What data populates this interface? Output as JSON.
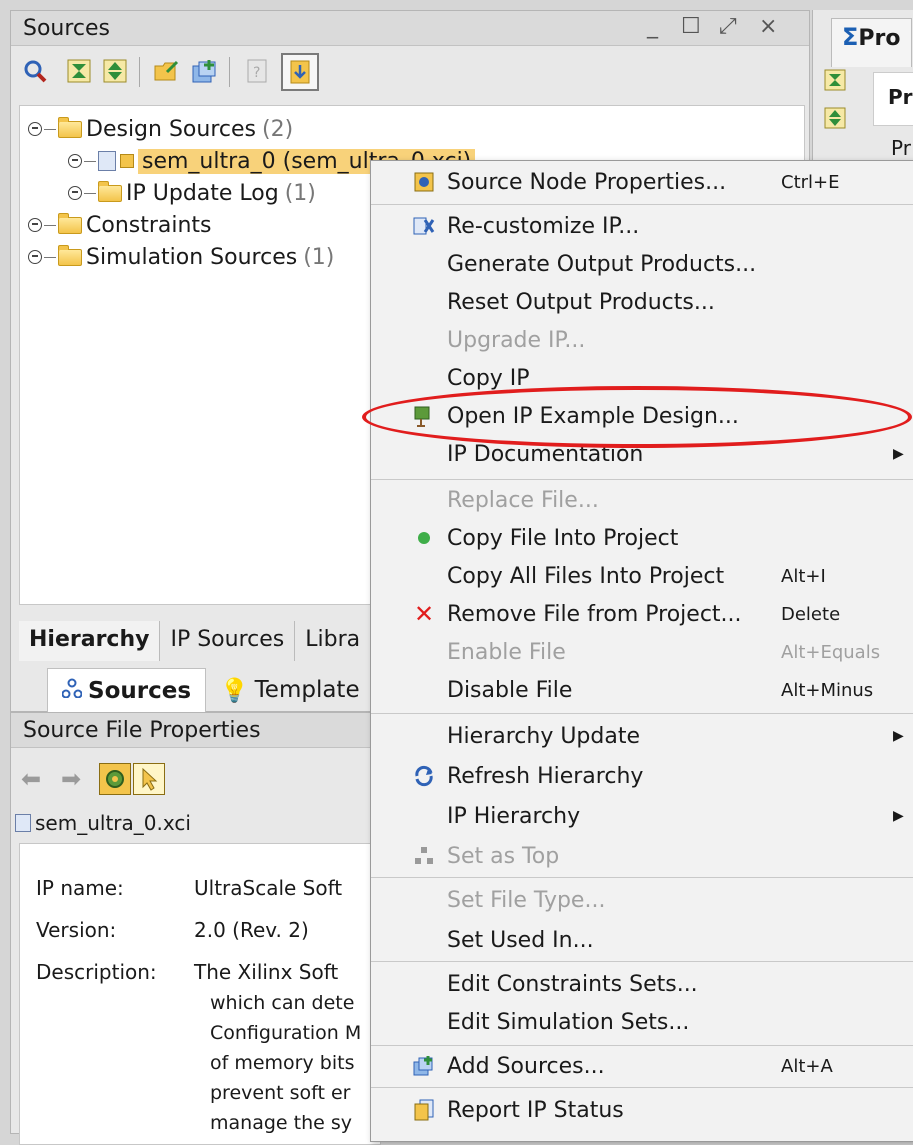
{
  "sources_panel": {
    "title": "Sources",
    "window_controls": {
      "minimize": "_",
      "maximize": "☐",
      "restore": "⤢",
      "close": "×"
    },
    "tree": [
      {
        "label": "Design Sources",
        "count": "(2)"
      },
      {
        "label": "sem_ultra_0 (sem_ultra_0.xci)",
        "count": ""
      },
      {
        "label": "IP Update Log",
        "count": "(1)"
      },
      {
        "label": "Constraints",
        "count": ""
      },
      {
        "label": "Simulation Sources",
        "count": "(1)"
      }
    ],
    "tabs": [
      "Hierarchy",
      "IP Sources",
      "Libra"
    ],
    "subtabs": [
      "Sources",
      "Template"
    ]
  },
  "properties_panel": {
    "title": "Source File Properties",
    "file": "sem_ultra_0.xci",
    "rows": [
      {
        "label": "IP name:",
        "value": "UltraScale Soft"
      },
      {
        "label": "Version:",
        "value": "2.0 (Rev. 2)"
      },
      {
        "label": "Description:",
        "value": "The Xilinx Soft"
      }
    ],
    "description_lines": [
      "which can dete",
      "Configuration M",
      "of memory bits",
      "prevent soft er",
      "manage the sy"
    ]
  },
  "right_panel": {
    "tab_label": "Pro",
    "header": "Pr",
    "row": "Pr"
  },
  "context_menu": {
    "items": [
      {
        "label": "Source Node Properties...",
        "shortcut": "Ctrl+E",
        "icon": "properties-icon",
        "disabled": false
      },
      {
        "label": "Re-customize IP...",
        "shortcut": "",
        "icon": "customize-ip-icon",
        "disabled": false
      },
      {
        "label": "Generate Output Products...",
        "shortcut": "",
        "icon": "",
        "disabled": false
      },
      {
        "label": "Reset Output Products...",
        "shortcut": "",
        "icon": "",
        "disabled": false
      },
      {
        "label": "Upgrade IP...",
        "shortcut": "",
        "icon": "",
        "disabled": true
      },
      {
        "label": "Copy IP",
        "shortcut": "",
        "icon": "",
        "disabled": false
      },
      {
        "label": "Open IP Example Design...",
        "shortcut": "",
        "icon": "example-design-icon",
        "disabled": false
      },
      {
        "label": "IP Documentation",
        "shortcut": "",
        "icon": "",
        "disabled": false,
        "submenu": true
      },
      {
        "label": "Replace File...",
        "shortcut": "",
        "icon": "",
        "disabled": true
      },
      {
        "label": "Copy File Into Project",
        "shortcut": "",
        "icon": "green-dot-icon",
        "disabled": false
      },
      {
        "label": "Copy All Files Into Project",
        "shortcut": "Alt+I",
        "icon": "",
        "disabled": false
      },
      {
        "label": "Remove File from Project...",
        "shortcut": "Delete",
        "icon": "remove-icon",
        "disabled": false
      },
      {
        "label": "Enable File",
        "shortcut": "Alt+Equals",
        "icon": "",
        "disabled": true
      },
      {
        "label": "Disable File",
        "shortcut": "Alt+Minus",
        "icon": "",
        "disabled": false
      },
      {
        "label": "Hierarchy Update",
        "shortcut": "",
        "icon": "",
        "disabled": false,
        "submenu": true
      },
      {
        "label": "Refresh Hierarchy",
        "shortcut": "",
        "icon": "refresh-icon",
        "disabled": false
      },
      {
        "label": "IP Hierarchy",
        "shortcut": "",
        "icon": "",
        "disabled": false,
        "submenu": true
      },
      {
        "label": "Set as Top",
        "shortcut": "",
        "icon": "hierarchy-icon",
        "disabled": true
      },
      {
        "label": "Set File Type...",
        "shortcut": "",
        "icon": "",
        "disabled": true
      },
      {
        "label": "Set Used In...",
        "shortcut": "",
        "icon": "",
        "disabled": false
      },
      {
        "label": "Edit Constraints Sets...",
        "shortcut": "",
        "icon": "",
        "disabled": false
      },
      {
        "label": "Edit Simulation Sets...",
        "shortcut": "",
        "icon": "",
        "disabled": false
      },
      {
        "label": "Add Sources...",
        "shortcut": "Alt+A",
        "icon": "add-sources-icon",
        "disabled": false
      },
      {
        "label": "Report IP Status",
        "shortcut": "",
        "icon": "report-icon",
        "disabled": false
      }
    ]
  },
  "colors": {
    "highlight": "#e11d1d",
    "selection": "#f8d27a"
  }
}
